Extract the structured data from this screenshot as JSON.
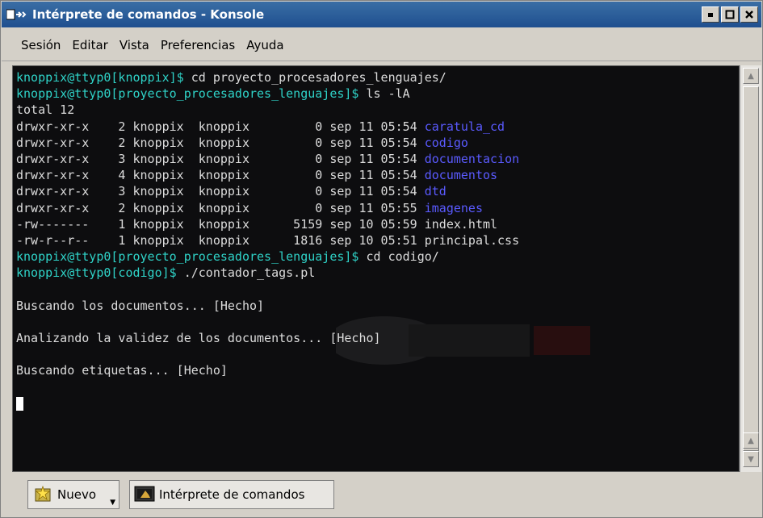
{
  "window": {
    "title": "Intérprete de comandos - Konsole",
    "icon": "terminal-app-icon"
  },
  "window_buttons": [
    "minimize-icon",
    "maximize-icon",
    "close-icon"
  ],
  "menu": {
    "items": [
      "Sesión",
      "Editar",
      "Vista",
      "Preferencias",
      "Ayuda"
    ]
  },
  "terminal": {
    "background_color": "#0d0d0f",
    "prompt_color": "#2fd3c8",
    "directory_color": "#5a5aff",
    "text_color": "#dcdcdc",
    "lines": [
      {
        "prompt": "knoppix@ttyp0[knoppix]$",
        "cmd": " cd proyecto_procesadores_lenguajes/"
      },
      {
        "prompt": "knoppix@ttyp0[proyecto_procesadores_lenguajes]$",
        "cmd": " ls -lA"
      },
      {
        "text": "total 12"
      },
      {
        "text": "drwxr-xr-x    2 knoppix  knoppix         0 sep 11 05:54 ",
        "dir": "caratula_cd"
      },
      {
        "text": "drwxr-xr-x    2 knoppix  knoppix         0 sep 11 05:54 ",
        "dir": "codigo"
      },
      {
        "text": "drwxr-xr-x    3 knoppix  knoppix         0 sep 11 05:54 ",
        "dir": "documentacion"
      },
      {
        "text": "drwxr-xr-x    4 knoppix  knoppix         0 sep 11 05:54 ",
        "dir": "documentos"
      },
      {
        "text": "drwxr-xr-x    3 knoppix  knoppix         0 sep 11 05:54 ",
        "dir": "dtd"
      },
      {
        "text": "drwxr-xr-x    2 knoppix  knoppix         0 sep 11 05:55 ",
        "dir": "imagenes"
      },
      {
        "text": "-rw-------    1 knoppix  knoppix      5159 sep 10 05:59 index.html"
      },
      {
        "text": "-rw-r--r--    1 knoppix  knoppix      1816 sep 10 05:51 principal.css"
      },
      {
        "prompt": "knoppix@ttyp0[proyecto_procesadores_lenguajes]$",
        "cmd": " cd codigo/"
      },
      {
        "prompt": "knoppix@ttyp0[codigo]$",
        "cmd": " ./contador_tags.pl"
      },
      {
        "text": ""
      },
      {
        "text": "Buscando los documentos... [Hecho]"
      },
      {
        "text": ""
      },
      {
        "text": "Analizando la validez de los documentos... [Hecho]"
      },
      {
        "text": ""
      },
      {
        "text": "Buscando etiquetas... [Hecho]"
      },
      {
        "text": ""
      },
      {
        "cursor": true
      }
    ]
  },
  "taskbar": {
    "new_label": "Nuevo",
    "new_icon": "new-session-icon",
    "session_label": "Intérprete de comandos",
    "session_icon": "konsole-session-icon"
  }
}
